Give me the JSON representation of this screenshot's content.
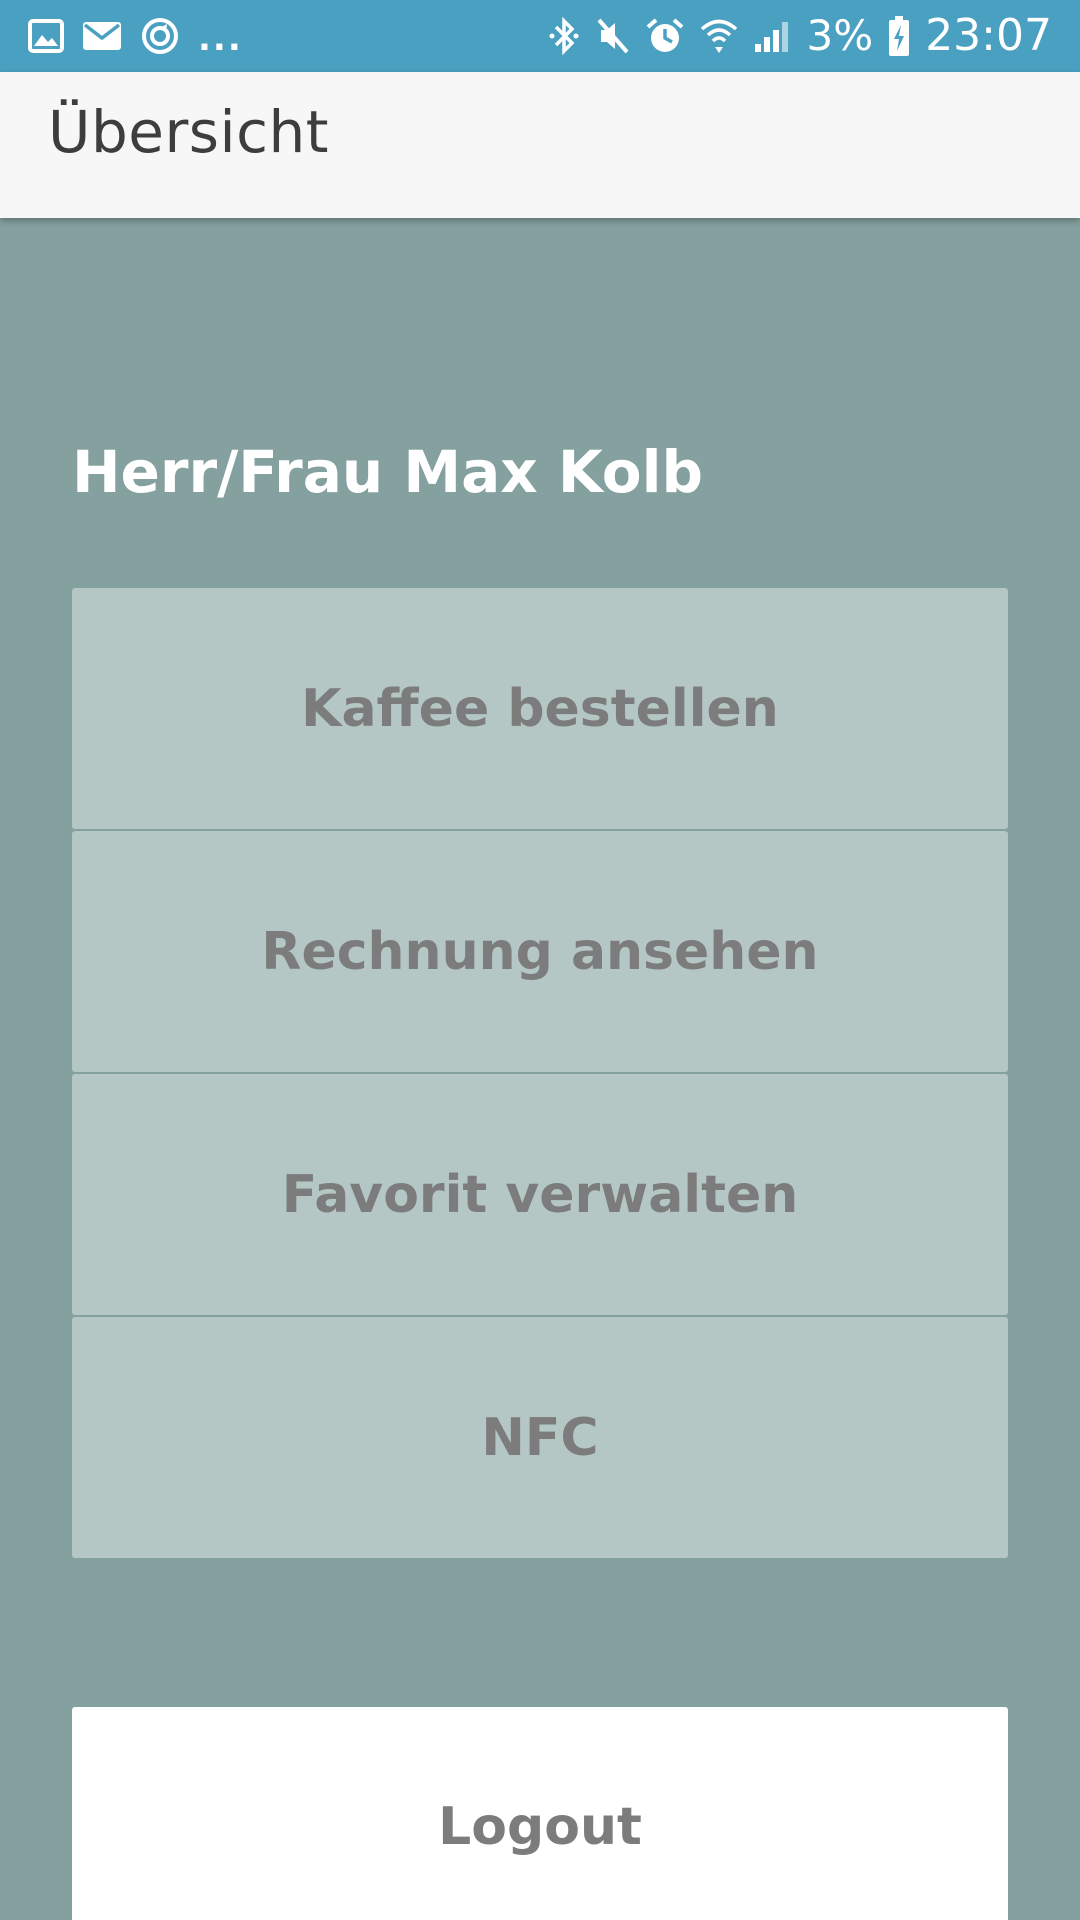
{
  "status_bar": {
    "background": "#4aa0c1",
    "left_icons": [
      "gallery-icon",
      "mail-icon",
      "sync-icon"
    ],
    "overflow": "...",
    "right_icons": [
      "bluetooth-icon",
      "mute-icon",
      "alarm-icon",
      "wifi-icon",
      "signal-icon"
    ],
    "battery_percent": "3%",
    "time": "23:07"
  },
  "app_bar": {
    "title": "Übersicht"
  },
  "main": {
    "greeting": "Herr/Frau Max Kolb",
    "buttons": [
      {
        "label": "Kaffee bestellen"
      },
      {
        "label": "Rechnung ansehen"
      },
      {
        "label": "Favorit verwalten"
      },
      {
        "label": "NFC"
      }
    ],
    "logout_label": "Logout"
  },
  "colors": {
    "page_background": "#84a09f",
    "button_background": "#b4c7c5",
    "button_text": "#7c7c7c",
    "app_bar_background": "#f7f7f7"
  }
}
